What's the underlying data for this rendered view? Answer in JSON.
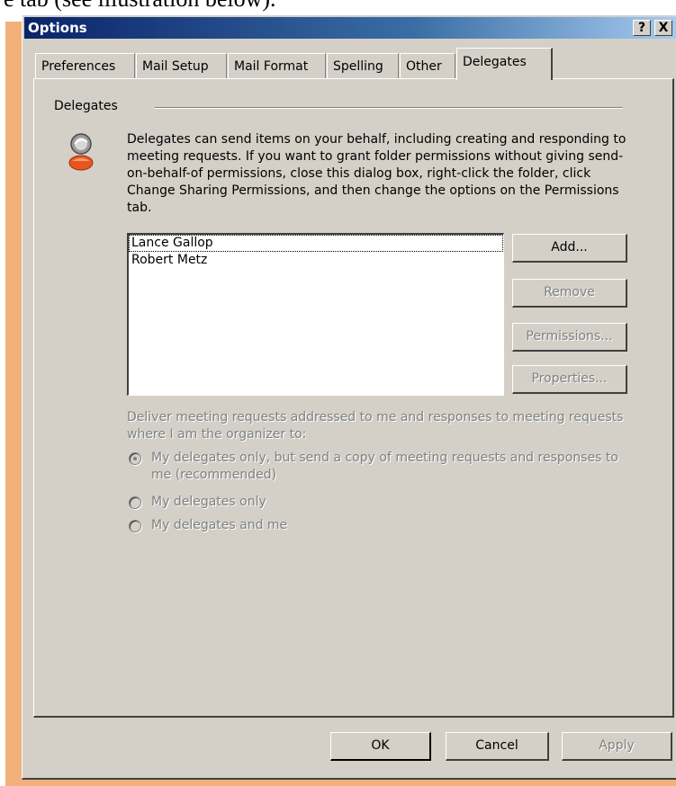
{
  "caption": "e tab (see illustration below).",
  "window": {
    "title": "Options",
    "help_label": "?",
    "close_label": "X"
  },
  "tabs": [
    {
      "label": "Preferences"
    },
    {
      "label": "Mail Setup"
    },
    {
      "label": "Mail Format"
    },
    {
      "label": "Spelling"
    },
    {
      "label": "Other"
    },
    {
      "label": "Delegates",
      "active": true
    }
  ],
  "delegates": {
    "group_label": "Delegates",
    "description": "Delegates can send items on your behalf, including creating and responding to meeting requests. If you want to grant folder permissions without giving send-on-behalf-of permissions, close this dialog box, right-click the folder, click Change Sharing Permissions, and then change the options on the Permissions tab.",
    "list": [
      "Lance Gallop",
      "Robert Metz"
    ],
    "buttons": {
      "add": "Add...",
      "remove": "Remove",
      "permissions": "Permissions...",
      "properties": "Properties..."
    },
    "deliver_label": "Deliver meeting requests addressed to me and responses to meeting requests where I am the organizer to:",
    "options": [
      {
        "label": "My delegates only, but send a copy of meeting requests and responses to me (recommended)",
        "selected": true
      },
      {
        "label": "My delegates only",
        "selected": false
      },
      {
        "label": "My delegates and me",
        "selected": false
      }
    ]
  },
  "footer": {
    "ok": "OK",
    "cancel": "Cancel",
    "apply": "Apply"
  },
  "icons": {
    "delegate_icon": "user-icon"
  }
}
